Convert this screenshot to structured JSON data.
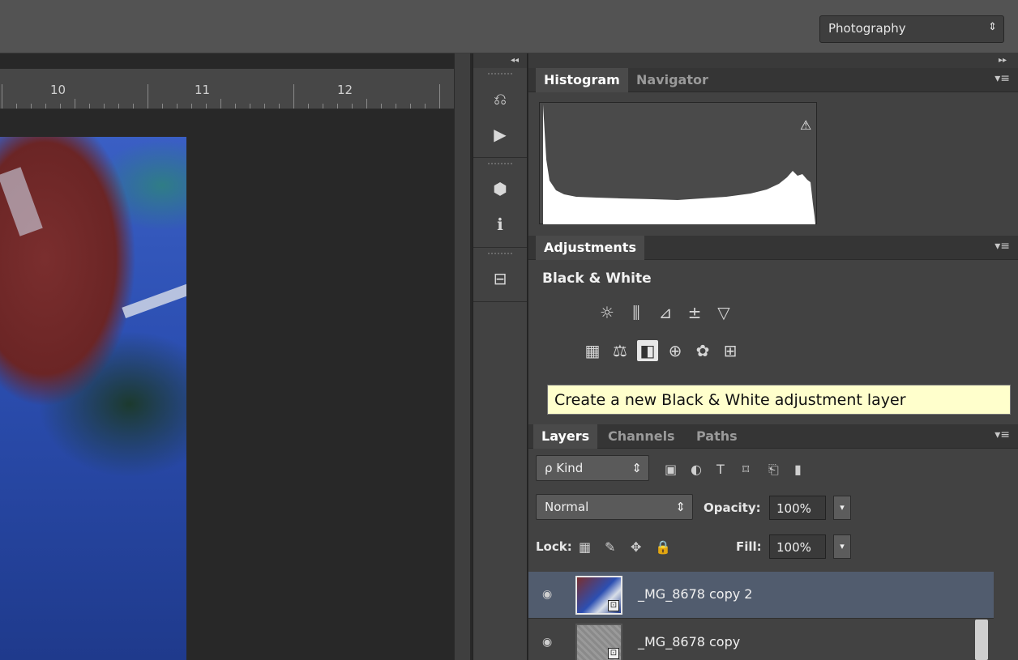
{
  "workspace": {
    "label": "Photography",
    "chevron": "⇕"
  },
  "ruler": {
    "labels": [
      "10",
      "11",
      "12"
    ]
  },
  "dock": {
    "collapse_glyph": "◂◂",
    "items": [
      {
        "name": "history",
        "glyph": "⎌"
      },
      {
        "name": "actions",
        "glyph": "▶"
      },
      {
        "name": "3d",
        "glyph": "⬢"
      },
      {
        "name": "info",
        "glyph": "ℹ"
      },
      {
        "name": "layer-comps",
        "glyph": "⊟"
      }
    ]
  },
  "panels": {
    "expand_glyph": "▸▸",
    "menu_glyph": "▾≡",
    "histogram_group": {
      "tabs": [
        "Histogram",
        "Navigator"
      ],
      "active": "Histogram",
      "warning_glyph": "⚠"
    },
    "adjustments": {
      "tab": "Adjustments",
      "title": "Black & White",
      "row1": [
        "☼",
        "⫼",
        "⊿",
        "±",
        "▽"
      ],
      "row2": [
        "▦",
        "⚖",
        "◧",
        "⊕",
        "✿",
        "⊞"
      ],
      "row2_selected_index": 2
    },
    "tooltip": "Create a new Black & White adjustment layer",
    "layers": {
      "tabs": [
        "Layers",
        "Channels",
        "Paths"
      ],
      "active": "Layers",
      "filter": {
        "label": "ρ Kind",
        "chevron": "⇕",
        "icons": [
          "▣",
          "◐",
          "T",
          "⌑",
          "⎗",
          "▮"
        ]
      },
      "blend_mode": "Normal",
      "opacity_label": "Opacity:",
      "opacity": "100%",
      "lock_label": "Lock:",
      "lock_icons": [
        "▦",
        "✎",
        "✥",
        "🔒"
      ],
      "fill_label": "Fill:",
      "fill": "100%",
      "dropdown_glyph": "▾",
      "items": [
        {
          "name": "_MG_8678 copy 2",
          "eye": "◉",
          "smart": "⊡",
          "selected": true
        },
        {
          "name": "_MG_8678 copy",
          "eye": "◉",
          "smart": "⊡",
          "selected": false
        }
      ]
    }
  },
  "colors": {
    "tooltip_bg": "#ffffcc",
    "selected_layer": "#515c6e",
    "panel_bg": "#424242"
  }
}
